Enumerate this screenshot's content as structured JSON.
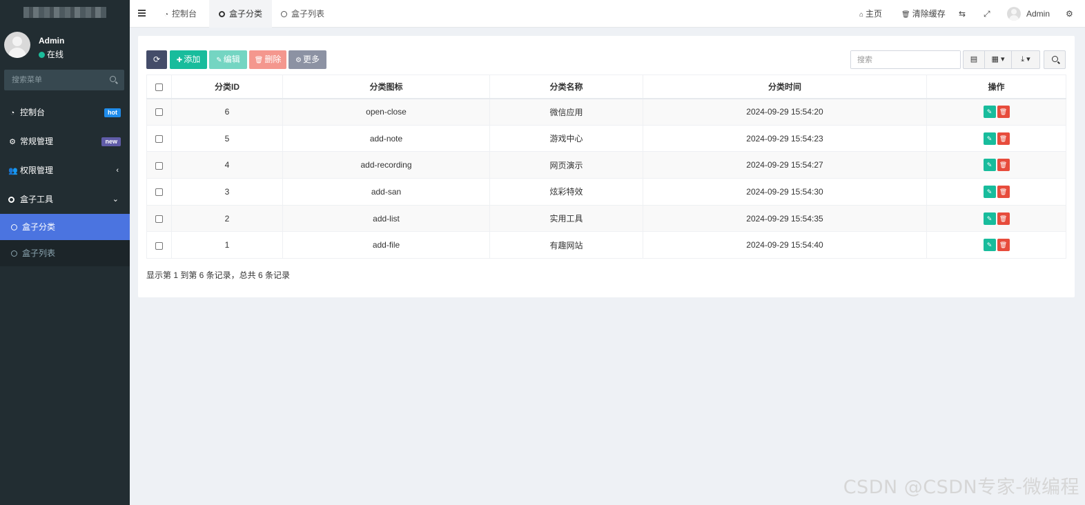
{
  "sidebar": {
    "user": {
      "name": "Admin",
      "status": "在线"
    },
    "search_placeholder": "搜索菜单",
    "items": [
      {
        "label": "控制台",
        "badge": "hot"
      },
      {
        "label": "常规管理",
        "badge": "new"
      },
      {
        "label": "权限管理",
        "arrow": "‹"
      },
      {
        "label": "盒子工具",
        "arrow": "⌄"
      }
    ],
    "submenu": [
      {
        "label": "盒子分类",
        "active": true
      },
      {
        "label": "盒子列表",
        "active": false
      }
    ]
  },
  "topbar": {
    "tabs": [
      {
        "label": "控制台"
      },
      {
        "label": "盒子分类"
      },
      {
        "label": "盒子列表"
      }
    ],
    "home": "主页",
    "clear_cache": "清除缓存",
    "user": "Admin"
  },
  "toolbar": {
    "add": "添加",
    "edit": "编辑",
    "delete": "删除",
    "more": "更多",
    "search_placeholder": "搜索"
  },
  "table": {
    "headers": [
      "分类ID",
      "分类图标",
      "分类名称",
      "分类时间",
      "操作"
    ],
    "rows": [
      {
        "id": "6",
        "icon": "open-close",
        "name": "微信应用",
        "time": "2024-09-29 15:54:20"
      },
      {
        "id": "5",
        "icon": "add-note",
        "name": "游戏中心",
        "time": "2024-09-29 15:54:23"
      },
      {
        "id": "4",
        "icon": "add-recording",
        "name": "网页演示",
        "time": "2024-09-29 15:54:27"
      },
      {
        "id": "3",
        "icon": "add-san",
        "name": "炫彩特效",
        "time": "2024-09-29 15:54:30"
      },
      {
        "id": "2",
        "icon": "add-list",
        "name": "实用工具",
        "time": "2024-09-29 15:54:35"
      },
      {
        "id": "1",
        "icon": "add-file",
        "name": "有趣网站",
        "time": "2024-09-29 15:54:40"
      }
    ]
  },
  "pagination": {
    "info": "显示第 1 到第 6 条记录，总共 6 条记录"
  },
  "watermark": "CSDN @CSDN专家-微编程",
  "colors": {
    "sidebar_bg": "#222d32",
    "active_item": "#4b74e0",
    "success": "#18bc9c",
    "danger": "#e74c3c"
  }
}
